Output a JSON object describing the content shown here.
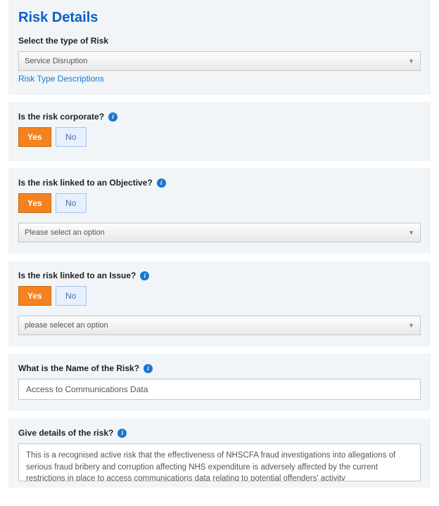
{
  "header": {
    "title": "Risk Details"
  },
  "riskType": {
    "label": "Select the type of Risk",
    "selected": "Service Disruption",
    "descriptionsLink": "Risk Type Descriptions"
  },
  "corporate": {
    "label": "Is the risk corporate?",
    "yes": "Yes",
    "no": "No"
  },
  "objective": {
    "label": "Is the risk linked to an Objective?",
    "yes": "Yes",
    "no": "No",
    "select": "Please select an option"
  },
  "issue": {
    "label": "Is the risk linked to an Issue?",
    "yes": "Yes",
    "no": "No",
    "select": "please selecet an option"
  },
  "riskName": {
    "label": "What is the Name of the Risk?",
    "value": "Access to Communications Data"
  },
  "details": {
    "label": "Give details of the risk?",
    "value": "This is a recognised active risk that the effectiveness of NHSCFA fraud investigations into allegations of serious fraud bribery and corruption affecting NHS expenditure is adversely affected by the current restrictions in place to access communications data relating to potential offenders' activity"
  }
}
